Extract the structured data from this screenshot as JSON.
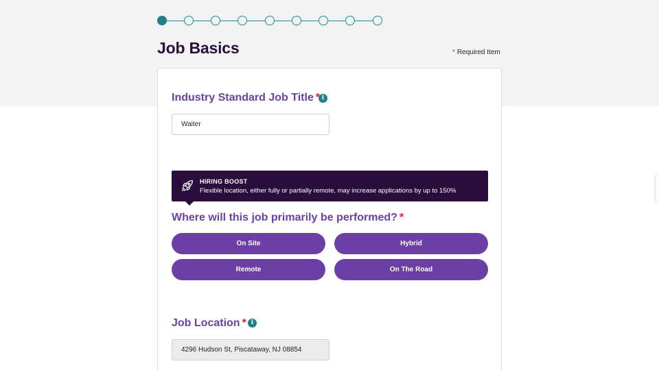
{
  "stepper": {
    "total": 9,
    "current": 1
  },
  "page": {
    "title": "Job Basics",
    "required_star": "*",
    "required_note": "Required Item"
  },
  "job_title": {
    "label": "Industry Standard Job Title",
    "star": "*",
    "info_icon": "i",
    "value": "Waiter"
  },
  "hiring_boost": {
    "icon": "rocket-icon",
    "title": "HIRING BOOST",
    "text": "Flexible location, either fully or partially remote, may increase applications by up to 150%"
  },
  "work_location": {
    "label": "Where will this job primarily be performed?",
    "star": "*",
    "options": [
      "On Site",
      "Hybrid",
      "Remote",
      "On The Road"
    ]
  },
  "job_location": {
    "label": "Job Location",
    "star": "*",
    "info_icon": "i",
    "value": "4296 Hudson St, Piscataway, NJ 08854"
  },
  "colors": {
    "accent_purple": "#6b3fa6",
    "dark_purple": "#2a0d3d",
    "teal": "#1f7f8a",
    "required_red": "#e0203a"
  }
}
